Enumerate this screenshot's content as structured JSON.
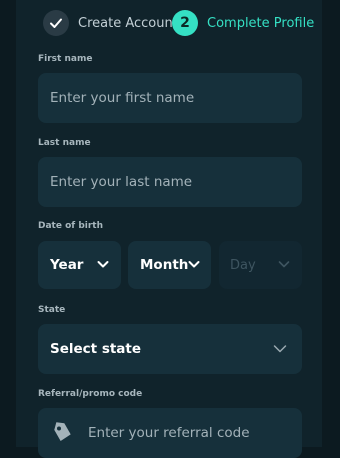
{
  "stepper": {
    "step1_label": "Create Account",
    "step2_number": "2",
    "step2_label": "Complete Profile"
  },
  "form": {
    "first_name": {
      "label": "First name",
      "placeholder": "Enter your first name"
    },
    "last_name": {
      "label": "Last name",
      "placeholder": "Enter your last name"
    },
    "dob": {
      "label": "Date of birth",
      "year": "Year",
      "month": "Month",
      "day": "Day"
    },
    "state": {
      "label": "State",
      "value": "Select state"
    },
    "referral": {
      "label": "Referral/promo code",
      "placeholder": "Enter your referral code"
    }
  },
  "colors": {
    "accent": "#35e0c4",
    "background": "#0c1a20",
    "panel": "#10232b",
    "field": "#16303b"
  }
}
